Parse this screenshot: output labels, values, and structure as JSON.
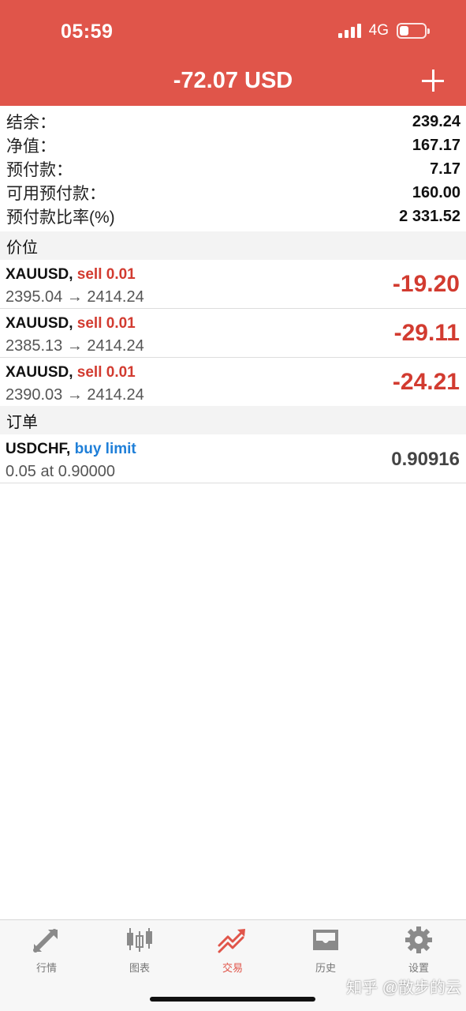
{
  "status_bar": {
    "time": "05:59",
    "network": "4G"
  },
  "header": {
    "title": "-72.07 USD",
    "add_icon": "plus-icon"
  },
  "summary": [
    {
      "label": "结余：",
      "value": "239.24"
    },
    {
      "label": "净值：",
      "value": "167.17"
    },
    {
      "label": "预付款：",
      "value": "7.17"
    },
    {
      "label": "可用预付款：",
      "value": "160.00"
    },
    {
      "label": "预付款比率(%)",
      "value": "2 331.52"
    }
  ],
  "positions_section": {
    "title": "价位"
  },
  "positions": [
    {
      "symbol": "XAUUSD,",
      "side": "sell 0.01",
      "prices": "2395.04 → 2414.24",
      "profit": "-19.20"
    },
    {
      "symbol": "XAUUSD,",
      "side": "sell 0.01",
      "prices": "2385.13 → 2414.24",
      "profit": "-29.11"
    },
    {
      "symbol": "XAUUSD,",
      "side": "sell 0.01",
      "prices": "2390.03 → 2414.24",
      "profit": "-24.21"
    }
  ],
  "orders_section": {
    "title": "订单"
  },
  "orders": [
    {
      "symbol": "USDCHF,",
      "side": "buy limit",
      "detail": "0.05 at 0.90000",
      "price": "0.90916"
    }
  ],
  "tabs": [
    {
      "label": "行情",
      "icon": "quotes-arrows-icon",
      "active": false
    },
    {
      "label": "图表",
      "icon": "candlestick-chart-icon",
      "active": false
    },
    {
      "label": "交易",
      "icon": "trade-trend-icon",
      "active": true
    },
    {
      "label": "历史",
      "icon": "history-inbox-icon",
      "active": false
    },
    {
      "label": "设置",
      "icon": "gear-icon",
      "active": false
    }
  ],
  "watermark": "知乎 @散步的云",
  "colors": {
    "header": "#e0554a",
    "loss": "#d23b30",
    "buy": "#1f7fd8",
    "active_tab": "#e0554a"
  }
}
